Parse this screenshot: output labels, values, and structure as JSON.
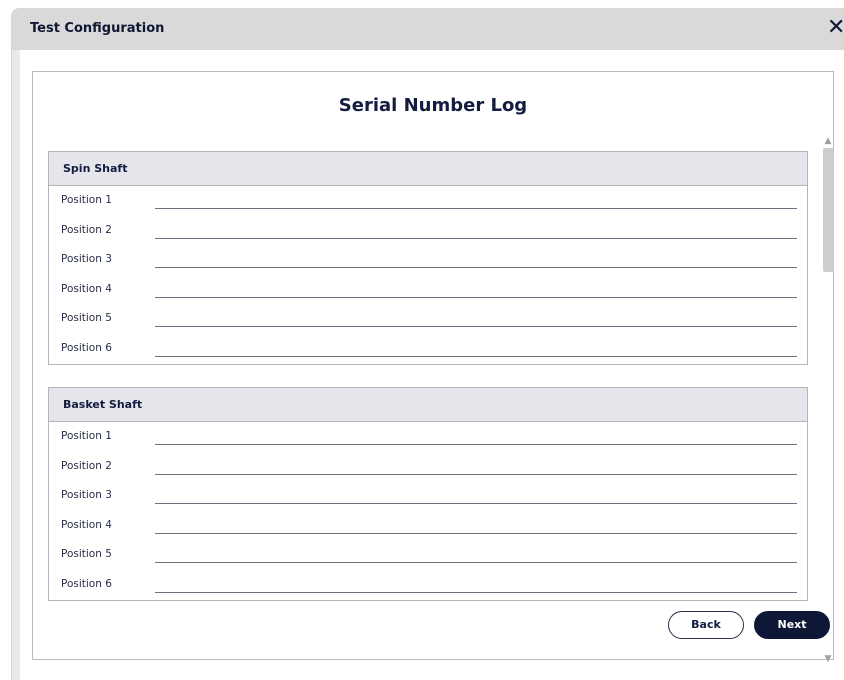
{
  "window": {
    "title": "Test Configuration",
    "close_icon": "close-icon"
  },
  "panel": {
    "title": "Serial Number Log"
  },
  "sections": [
    {
      "header": "Spin Shaft",
      "rows": [
        "Position 1",
        "Position 2",
        "Position 3",
        "Position 4",
        "Position 5",
        "Position 6"
      ]
    },
    {
      "header": "Basket Shaft",
      "rows": [
        "Position 1",
        "Position 2",
        "Position 3",
        "Position 4",
        "Position 5",
        "Position 6"
      ]
    }
  ],
  "buttons": {
    "back": "Back",
    "next": "Next"
  },
  "colors": {
    "accent": "#0f1736",
    "header_bg": "#e5e6eb",
    "titlebar_bg": "#d9d9d9"
  }
}
